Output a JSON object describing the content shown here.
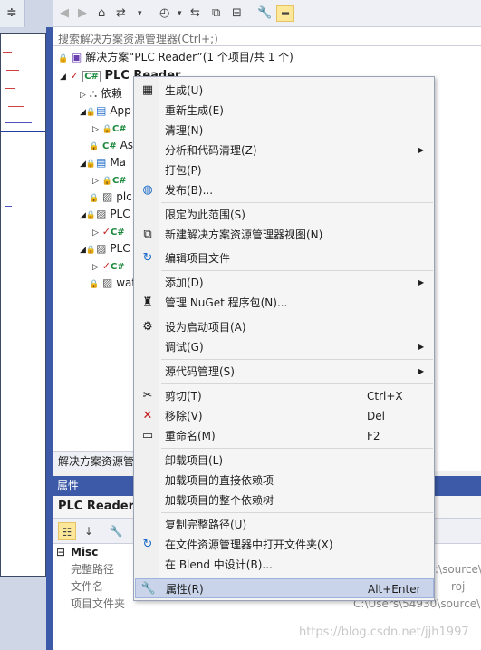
{
  "left_strip": {
    "top_icon": "split-icon"
  },
  "toolbar": {
    "icons": [
      "back-icon",
      "forward-icon",
      "home-icon",
      "sync-icon",
      "dropdown-icon",
      "history-icon",
      "dropdown-icon",
      "swap-icon",
      "copy-icon",
      "collapse-icon",
      "wrench-icon",
      "pin-icon"
    ]
  },
  "search": {
    "placeholder": "搜索解决方案资源管理器(Ctrl+;)"
  },
  "tree": {
    "solution": "解决方案“PLC Reader”(1 个项目/共 1 个)",
    "project": "PLC Reader",
    "items": [
      {
        "label": "依赖"
      },
      {
        "label": "App"
      },
      {
        "label": "Ass"
      },
      {
        "label": "Ma"
      },
      {
        "label": "plc."
      },
      {
        "label": "PLC"
      },
      {
        "label": "PLC"
      },
      {
        "label": "wat"
      }
    ],
    "cs": "C#"
  },
  "se_status": "解决方案资源管",
  "properties": {
    "header": "属性",
    "object": "PLC Reader 项",
    "category": "Misc",
    "rows": [
      {
        "key": "完整路径",
        "value": ":\\source\\"
      },
      {
        "key": "文件名",
        "value": "roj"
      },
      {
        "key": "项目文件夹",
        "value": "C:\\Users\\54930\\source\\"
      }
    ]
  },
  "menu": {
    "items": [
      {
        "label": "生成(U)",
        "icon": "build-icon"
      },
      {
        "label": "重新生成(E)"
      },
      {
        "label": "清理(N)"
      },
      {
        "label": "分析和代码清理(Z)",
        "submenu": true
      },
      {
        "label": "打包(P)"
      },
      {
        "label": "发布(B)...",
        "icon": "globe-icon"
      },
      {
        "label": "限定为此范围(S)"
      },
      {
        "label": "新建解决方案资源管理器视图(N)",
        "icon": "new-view-icon"
      },
      {
        "label": "编辑项目文件",
        "icon": "edit-arrow-icon"
      },
      {
        "label": "添加(D)",
        "submenu": true
      },
      {
        "label": "管理 NuGet 程序包(N)...",
        "icon": "nuget-icon"
      },
      {
        "label": "设为启动项目(A)",
        "icon": "gear-icon"
      },
      {
        "label": "调试(G)",
        "submenu": true
      },
      {
        "label": "源代码管理(S)",
        "submenu": true
      },
      {
        "label": "剪切(T)",
        "shortcut": "Ctrl+X",
        "icon": "scissors-icon"
      },
      {
        "label": "移除(V)",
        "shortcut": "Del",
        "icon": "remove-icon"
      },
      {
        "label": "重命名(M)",
        "shortcut": "F2",
        "icon": "rename-icon"
      },
      {
        "label": "卸载项目(L)"
      },
      {
        "label": "加载项目的直接依赖项"
      },
      {
        "label": "加载项目的整个依赖树"
      },
      {
        "label": "复制完整路径(U)"
      },
      {
        "label": "在文件资源管理器中打开文件夹(X)",
        "icon": "open-folder-icon"
      },
      {
        "label": "在 Blend 中设计(B)..."
      },
      {
        "label": "属性(R)",
        "shortcut": "Alt+Enter",
        "icon": "wrench-icon"
      }
    ]
  },
  "watermark": "https://blog.csdn.net/jjh1997",
  "colors": {
    "accent": "#3c5aa8",
    "highlight": "#c9d4ea"
  }
}
